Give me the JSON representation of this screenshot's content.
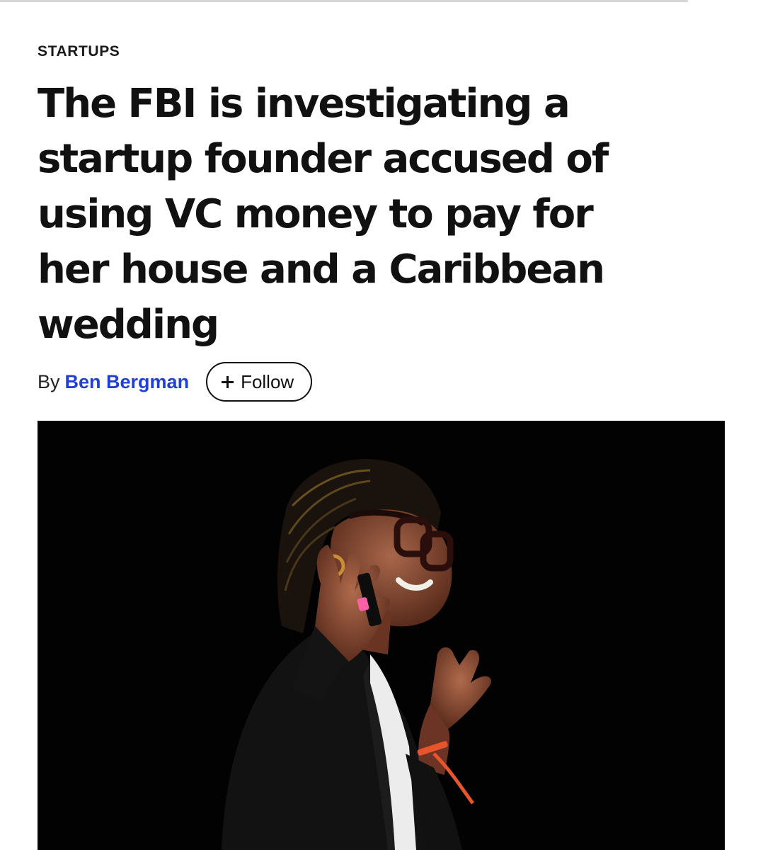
{
  "article": {
    "category": "STARTUPS",
    "headline": "The FBI is investigating a startup founder accused of using VC money to pay for her house and a Caribbean wedding",
    "byline": {
      "prefix": "By",
      "author": "Ben Bergman",
      "follow_label": "Follow",
      "follow_icon": "plus-icon"
    }
  },
  "colors": {
    "author_link": "#1f3fd6",
    "photo_background": "#020202"
  }
}
